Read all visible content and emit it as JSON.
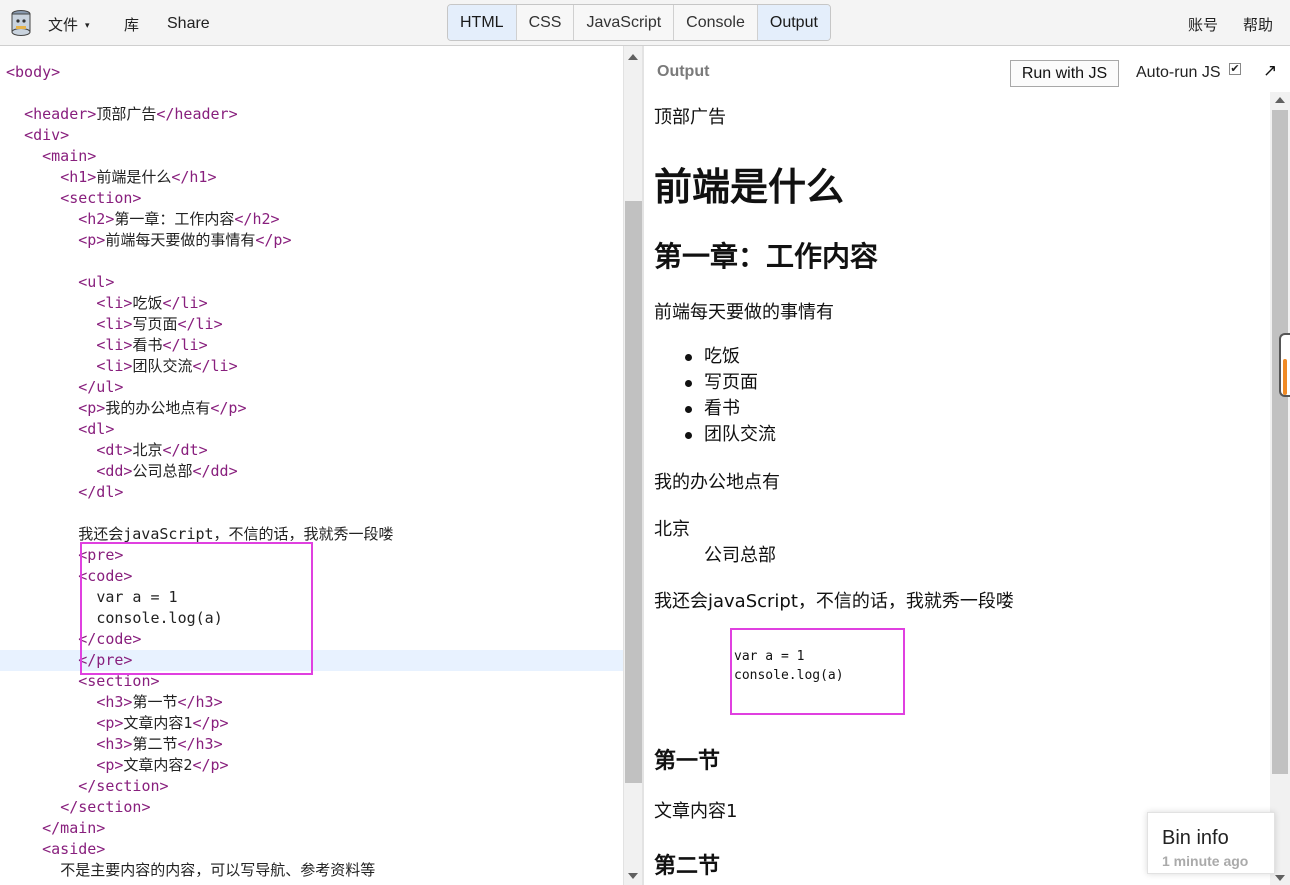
{
  "topbar": {
    "file_label": "文件",
    "file_caret": "▾",
    "library_label": "库",
    "share_label": "Share",
    "account_label": "账号",
    "help_label": "帮助",
    "tabs": [
      "HTML",
      "CSS",
      "JavaScript",
      "Console",
      "Output"
    ]
  },
  "editor": {
    "lines": [
      {
        "indent": "",
        "parts": [
          {
            "t": "tag",
            "v": "<body>"
          }
        ]
      },
      {
        "indent": "",
        "parts": []
      },
      {
        "indent": "  ",
        "parts": [
          {
            "t": "tag",
            "v": "<header>"
          },
          {
            "t": "txt",
            "v": "顶部广告"
          },
          {
            "t": "tag",
            "v": "</header>"
          }
        ]
      },
      {
        "indent": "  ",
        "parts": [
          {
            "t": "tag",
            "v": "<div>"
          }
        ]
      },
      {
        "indent": "    ",
        "parts": [
          {
            "t": "tag",
            "v": "<main>"
          }
        ]
      },
      {
        "indent": "      ",
        "parts": [
          {
            "t": "tag",
            "v": "<h1>"
          },
          {
            "t": "txt",
            "v": "前端是什么"
          },
          {
            "t": "tag",
            "v": "</h1>"
          }
        ]
      },
      {
        "indent": "      ",
        "parts": [
          {
            "t": "tag",
            "v": "<section>"
          }
        ]
      },
      {
        "indent": "        ",
        "parts": [
          {
            "t": "tag",
            "v": "<h2>"
          },
          {
            "t": "txt",
            "v": "第一章：工作内容"
          },
          {
            "t": "tag",
            "v": "</h2>"
          }
        ]
      },
      {
        "indent": "        ",
        "parts": [
          {
            "t": "tag",
            "v": "<p>"
          },
          {
            "t": "txt",
            "v": "前端每天要做的事情有"
          },
          {
            "t": "tag",
            "v": "</p>"
          }
        ]
      },
      {
        "indent": "",
        "parts": []
      },
      {
        "indent": "        ",
        "parts": [
          {
            "t": "tag",
            "v": "<ul>"
          }
        ]
      },
      {
        "indent": "          ",
        "parts": [
          {
            "t": "tag",
            "v": "<li>"
          },
          {
            "t": "txt",
            "v": "吃饭"
          },
          {
            "t": "tag",
            "v": "</li>"
          }
        ]
      },
      {
        "indent": "          ",
        "parts": [
          {
            "t": "tag",
            "v": "<li>"
          },
          {
            "t": "txt",
            "v": "写页面"
          },
          {
            "t": "tag",
            "v": "</li>"
          }
        ]
      },
      {
        "indent": "          ",
        "parts": [
          {
            "t": "tag",
            "v": "<li>"
          },
          {
            "t": "txt",
            "v": "看书"
          },
          {
            "t": "tag",
            "v": "</li>"
          }
        ]
      },
      {
        "indent": "          ",
        "parts": [
          {
            "t": "tag",
            "v": "<li>"
          },
          {
            "t": "txt",
            "v": "团队交流"
          },
          {
            "t": "tag",
            "v": "</li>"
          }
        ]
      },
      {
        "indent": "        ",
        "parts": [
          {
            "t": "tag",
            "v": "</ul>"
          }
        ]
      },
      {
        "indent": "        ",
        "parts": [
          {
            "t": "tag",
            "v": "<p>"
          },
          {
            "t": "txt",
            "v": "我的办公地点有"
          },
          {
            "t": "tag",
            "v": "</p>"
          }
        ]
      },
      {
        "indent": "        ",
        "parts": [
          {
            "t": "tag",
            "v": "<dl>"
          }
        ]
      },
      {
        "indent": "          ",
        "parts": [
          {
            "t": "tag",
            "v": "<dt>"
          },
          {
            "t": "txt",
            "v": "北京"
          },
          {
            "t": "tag",
            "v": "</dt>"
          }
        ]
      },
      {
        "indent": "          ",
        "parts": [
          {
            "t": "tag",
            "v": "<dd>"
          },
          {
            "t": "txt",
            "v": "公司总部"
          },
          {
            "t": "tag",
            "v": "</dd>"
          }
        ]
      },
      {
        "indent": "        ",
        "parts": [
          {
            "t": "tag",
            "v": "</dl>"
          }
        ]
      },
      {
        "indent": "",
        "parts": []
      },
      {
        "indent": "        ",
        "parts": [
          {
            "t": "txt",
            "v": "我还会javaScript，不信的话，我就秀一段喽"
          }
        ]
      },
      {
        "indent": "        ",
        "parts": [
          {
            "t": "tag",
            "v": "<pre>"
          }
        ]
      },
      {
        "indent": "        ",
        "parts": [
          {
            "t": "tag",
            "v": "<code>"
          }
        ]
      },
      {
        "indent": "          ",
        "parts": [
          {
            "t": "txt",
            "v": "var a = 1"
          }
        ]
      },
      {
        "indent": "          ",
        "parts": [
          {
            "t": "txt",
            "v": "console.log(a)"
          }
        ]
      },
      {
        "indent": "        ",
        "parts": [
          {
            "t": "tag",
            "v": "</code>"
          }
        ]
      },
      {
        "indent": "        ",
        "parts": [
          {
            "t": "tag",
            "v": "</pre>"
          }
        ],
        "highlight": true
      },
      {
        "indent": "        ",
        "parts": [
          {
            "t": "tag",
            "v": "<section>"
          }
        ]
      },
      {
        "indent": "          ",
        "parts": [
          {
            "t": "tag",
            "v": "<h3>"
          },
          {
            "t": "txt",
            "v": "第一节"
          },
          {
            "t": "tag",
            "v": "</h3>"
          }
        ]
      },
      {
        "indent": "          ",
        "parts": [
          {
            "t": "tag",
            "v": "<p>"
          },
          {
            "t": "txt",
            "v": "文章内容1"
          },
          {
            "t": "tag",
            "v": "</p>"
          }
        ]
      },
      {
        "indent": "          ",
        "parts": [
          {
            "t": "tag",
            "v": "<h3>"
          },
          {
            "t": "txt",
            "v": "第二节"
          },
          {
            "t": "tag",
            "v": "</h3>"
          }
        ]
      },
      {
        "indent": "          ",
        "parts": [
          {
            "t": "tag",
            "v": "<p>"
          },
          {
            "t": "txt",
            "v": "文章内容2"
          },
          {
            "t": "tag",
            "v": "</p>"
          }
        ]
      },
      {
        "indent": "        ",
        "parts": [
          {
            "t": "tag",
            "v": "</section>"
          }
        ]
      },
      {
        "indent": "      ",
        "parts": [
          {
            "t": "tag",
            "v": "</section>"
          }
        ]
      },
      {
        "indent": "    ",
        "parts": [
          {
            "t": "tag",
            "v": "</main>"
          }
        ]
      },
      {
        "indent": "    ",
        "parts": [
          {
            "t": "tag",
            "v": "<aside>"
          }
        ]
      },
      {
        "indent": "      ",
        "parts": [
          {
            "t": "txt",
            "v": "不是主要内容的内容，可以写导航、参考资料等"
          }
        ]
      }
    ]
  },
  "output": {
    "label": "Output",
    "run_button": "Run with JS",
    "autorun_label": "Auto-run JS",
    "autorun_checked": "✔",
    "expand_icon": "↗",
    "header_text": "顶部广告",
    "h1": "前端是什么",
    "h2": "第一章：工作内容",
    "p1": "前端每天要做的事情有",
    "list": [
      "吃饭",
      "写页面",
      "看书",
      "团队交流"
    ],
    "p2": "我的办公地点有",
    "dt": "北京",
    "dd": "公司总部",
    "p3": "我还会javaScript，不信的话，我就秀一段喽",
    "pre_line1": "var a = 1",
    "pre_line2": "console.log(a)",
    "h3a": "第一节",
    "p4": "文章内容1",
    "h3b": "第二节"
  },
  "bininfo": {
    "title": "Bin info",
    "subtitle": "1 minute ago"
  },
  "colors": {
    "tag": "#881f7d",
    "highlight_box": "#e040e0",
    "active_tab": "#e4eefb"
  }
}
